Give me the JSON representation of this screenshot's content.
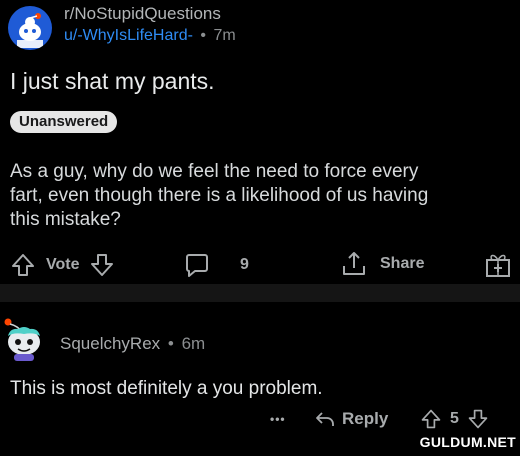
{
  "post": {
    "subreddit": "r/NoStupidQuestions",
    "author": "u/-WhyIsLifeHard-",
    "separator": "•",
    "age": "7m",
    "title": "I just shat my pants.",
    "flair": "Unanswered",
    "body_lines": [
      "As a guy, why do we feel the need to force every",
      "fart, even though there is a likelihood of us having",
      "this mistake?"
    ],
    "actions": {
      "vote_label": "Vote",
      "comment_count": "9",
      "share_label": "Share"
    },
    "icons": [
      "reddit-alien-avatar",
      "upvote-icon",
      "downvote-icon",
      "comment-icon",
      "share-icon",
      "award-gift-icon"
    ]
  },
  "comment": {
    "author": "SquelchyRex",
    "separator": "•",
    "age": "6m",
    "body": "This is most definitely a you problem.",
    "more_label": "•••",
    "reply_label": "Reply",
    "score": "5"
  },
  "watermark": "GULDUM.NET",
  "colors": {
    "background": "#000000",
    "band": "#151515",
    "link_blue": "#2f8cf4",
    "muted_text": "#a8abad",
    "flair_bg": "#e6e6e6"
  }
}
